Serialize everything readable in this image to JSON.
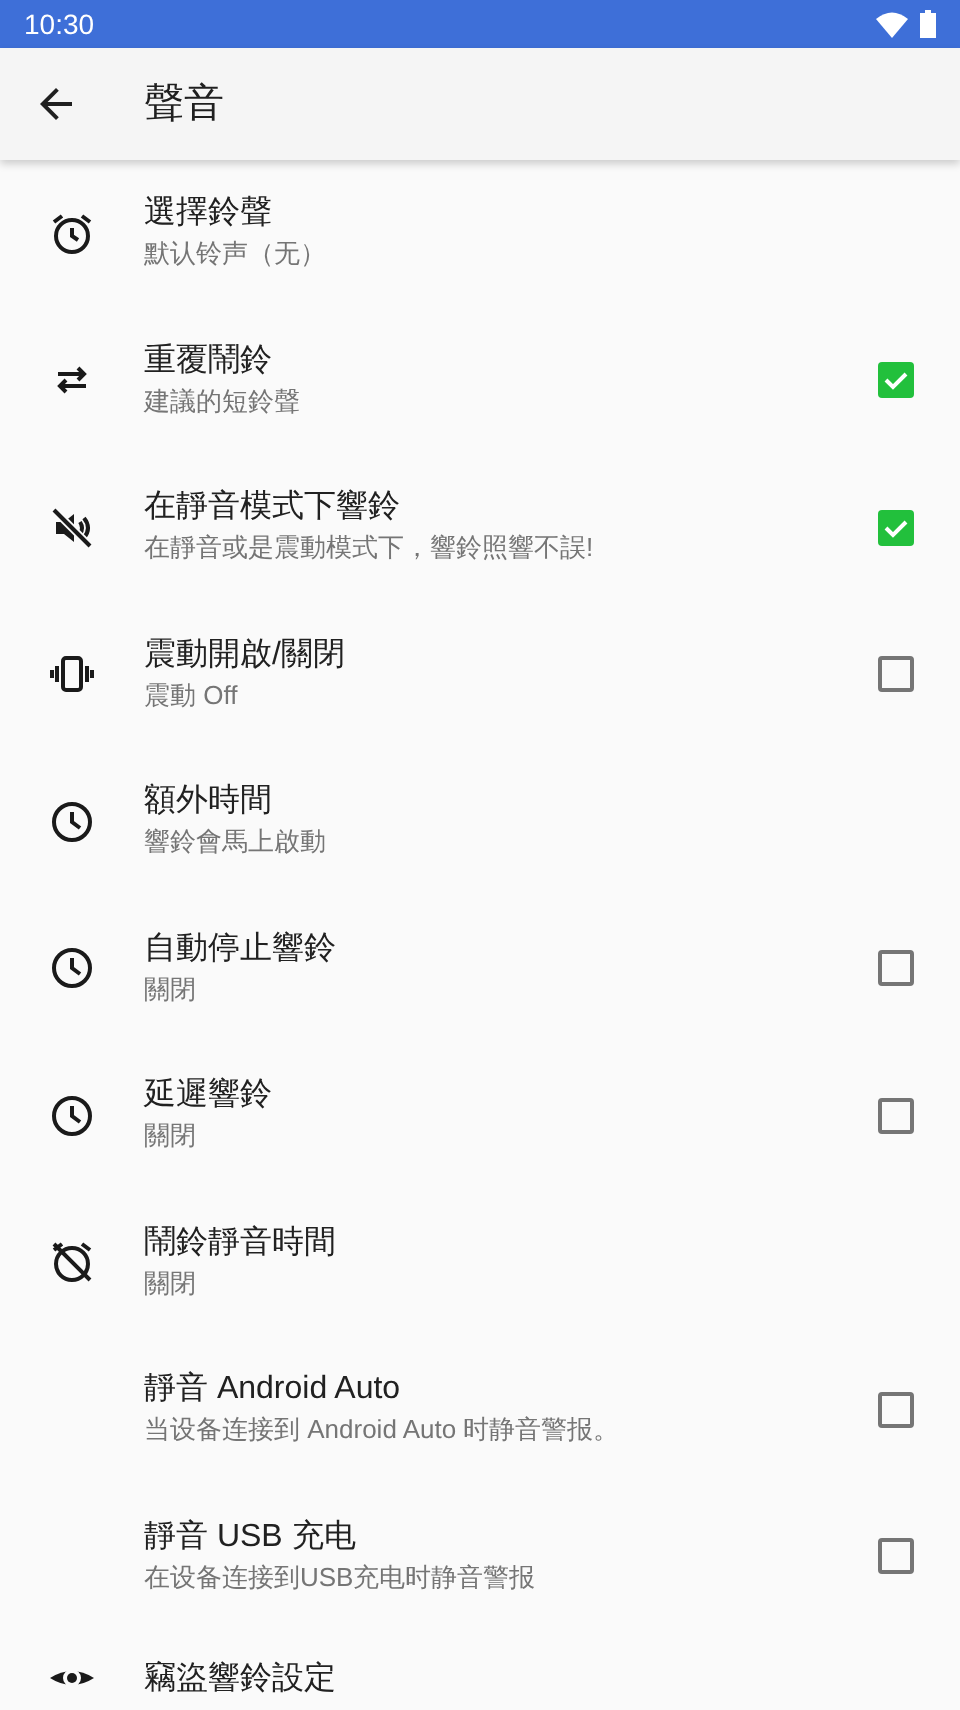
{
  "status_bar": {
    "time": "10:30"
  },
  "app_bar": {
    "title": "聲音"
  },
  "settings": [
    {
      "title": "選擇鈴聲",
      "subtitle": "默认铃声（无）",
      "kind": "plain"
    },
    {
      "title": "重覆鬧鈴",
      "subtitle": "建議的短鈴聲",
      "kind": "checkbox",
      "checked": true
    },
    {
      "title": "在靜音模式下響鈴",
      "subtitle": "在靜音或是震動模式下，響鈴照響不誤!",
      "kind": "checkbox",
      "checked": true
    },
    {
      "title": "震動開啟/關閉",
      "subtitle": "震動 Off",
      "kind": "checkbox",
      "checked": false
    },
    {
      "title": "額外時間",
      "subtitle": "響鈴會馬上啟動",
      "kind": "plain"
    },
    {
      "title": "自動停止響鈴",
      "subtitle": "關閉",
      "kind": "checkbox",
      "checked": false
    },
    {
      "title": "延遲響鈴",
      "subtitle": "關閉",
      "kind": "checkbox",
      "checked": false
    },
    {
      "title": "鬧鈴靜音時間",
      "subtitle": "關閉",
      "kind": "plain"
    },
    {
      "title": "靜音 Android Auto",
      "subtitle": "当设备连接到 Android Auto 时静音警报。",
      "kind": "checkbox",
      "checked": false
    },
    {
      "title": "靜音 USB 充电",
      "subtitle": "在设备连接到USB充电时静音警报",
      "kind": "checkbox",
      "checked": false
    },
    {
      "title": "竊盜響鈴設定",
      "kind": "plain"
    }
  ]
}
